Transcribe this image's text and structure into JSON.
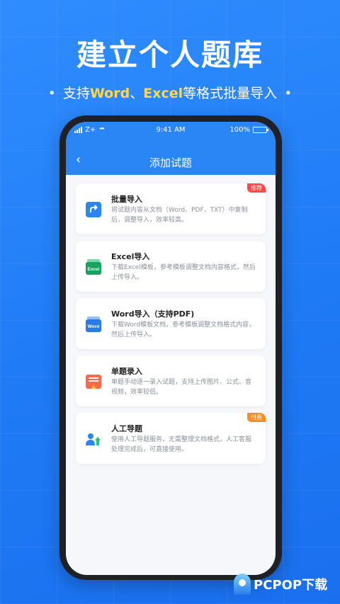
{
  "hero": {
    "title": "建立个人题库",
    "sub_prefix": "支持",
    "sub_word": "Word",
    "sub_sep": "、",
    "sub_excel": "Excel",
    "sub_suffix": "等格式批量导入",
    "dot": "•"
  },
  "status_bar": {
    "carrier": "Z+",
    "time": "9:41 AM",
    "battery": "100%"
  },
  "app": {
    "back_icon": "‹",
    "title": "添加试题"
  },
  "cards": [
    {
      "name": "批量导入",
      "desc": "将试题内容从文档（Word、PDF、TXT）中复制后，调整导入，效率较高。",
      "badge": "推荐",
      "icon": "share-arrow-icon"
    },
    {
      "name": "Excel导入",
      "desc": "下载Excel模板，参考模板调整文档内容格式，然后上传导入。",
      "badge": "",
      "icon": "excel-icon"
    },
    {
      "name": "Word导入（支持PDF)",
      "desc": "下载Word模板文档，参考模板调整文档格式内容，然后上传导入。",
      "badge": "",
      "icon": "word-icon"
    },
    {
      "name": "单题录入",
      "desc": "单题手动逐一录入试题，支持上传图片、公式、音视频，效率较低。",
      "badge": "",
      "icon": "single-entry-icon"
    },
    {
      "name": "人工导题",
      "desc": "使用人工导题服务，无需整理文档格式，人工客服处理完成后，可直接使用。",
      "badge": "付费",
      "icon": "manual-service-icon"
    }
  ],
  "icon_labels": {
    "excel": "Excel",
    "word": "Word"
  },
  "watermark": {
    "text": "PCPOP下载"
  },
  "colors": {
    "brand_blue": "#2a86f5",
    "highlight_yellow": "#ffd84a",
    "badge_red": "#ff4a4a",
    "badge_orange": "#ff8a1f"
  }
}
